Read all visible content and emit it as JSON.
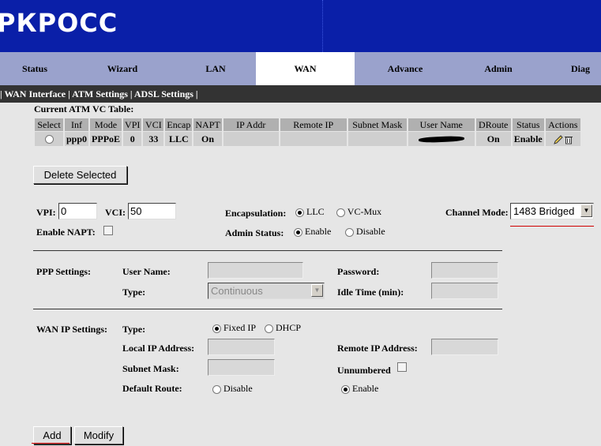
{
  "banner": {
    "logo_text": "РКРОСС"
  },
  "nav": {
    "tabs": [
      {
        "label": "Status"
      },
      {
        "label": "Wizard"
      },
      {
        "label": "LAN"
      },
      {
        "label": "WAN",
        "active": true
      },
      {
        "label": "Advance"
      },
      {
        "label": "Admin"
      },
      {
        "label": "Diag"
      }
    ]
  },
  "subnav": {
    "items": [
      "WAN Interface",
      "ATM Settings",
      "ADSL Settings"
    ],
    "separator": "|"
  },
  "vc_table": {
    "title": "Current ATM VC Table:",
    "headers": [
      "Select",
      "Inf",
      "Mode",
      "VPI",
      "VCI",
      "Encap",
      "NAPT",
      "IP Addr",
      "Remote IP",
      "Subnet Mask",
      "User Name",
      "DRoute",
      "Status",
      "Actions"
    ],
    "rows": [
      {
        "inf": "ppp0",
        "mode": "PPPoE",
        "vpi": "0",
        "vci": "33",
        "encap": "LLC",
        "napt": "On",
        "ip_addr": "",
        "remote_ip": "",
        "subnet_mask": "",
        "droute": "On",
        "status": "Enable"
      }
    ]
  },
  "buttons": {
    "delete_selected": "Delete Selected",
    "add": "Add",
    "modify": "Modify"
  },
  "form": {
    "vpi_label": "VPI:",
    "vpi_value": "0",
    "vci_label": "VCI:",
    "vci_value": "50",
    "encapsulation_label": "Encapsulation:",
    "encap_llc": "LLC",
    "encap_vcmux": "VC-Mux",
    "channel_mode_label": "Channel Mode:",
    "channel_mode_value": "1483 Bridged",
    "enable_napt_label": "Enable NAPT:",
    "admin_status_label": "Admin Status:",
    "admin_enable": "Enable",
    "admin_disable": "Disable"
  },
  "ppp": {
    "section_label": "PPP Settings:",
    "user_name_label": "User Name:",
    "password_label": "Password:",
    "type_label": "Type:",
    "type_value": "Continuous",
    "idle_time_label": "Idle Time (min):"
  },
  "wan_ip": {
    "section_label": "WAN IP Settings:",
    "type_label": "Type:",
    "fixed_ip": "Fixed IP",
    "dhcp": "DHCP",
    "local_ip_label": "Local IP Address:",
    "remote_ip_label": "Remote IP Address:",
    "subnet_mask_label": "Subnet Mask:",
    "unnumbered_label": "Unnumbered",
    "default_route_label": "Default Route:",
    "route_disable": "Disable",
    "route_enable": "Enable"
  },
  "colors": {
    "banner": "#0a1fa8",
    "nav": "#9aa2cc",
    "subnav": "#333333",
    "background": "#e6e6e6",
    "annotation": "#d00000"
  }
}
